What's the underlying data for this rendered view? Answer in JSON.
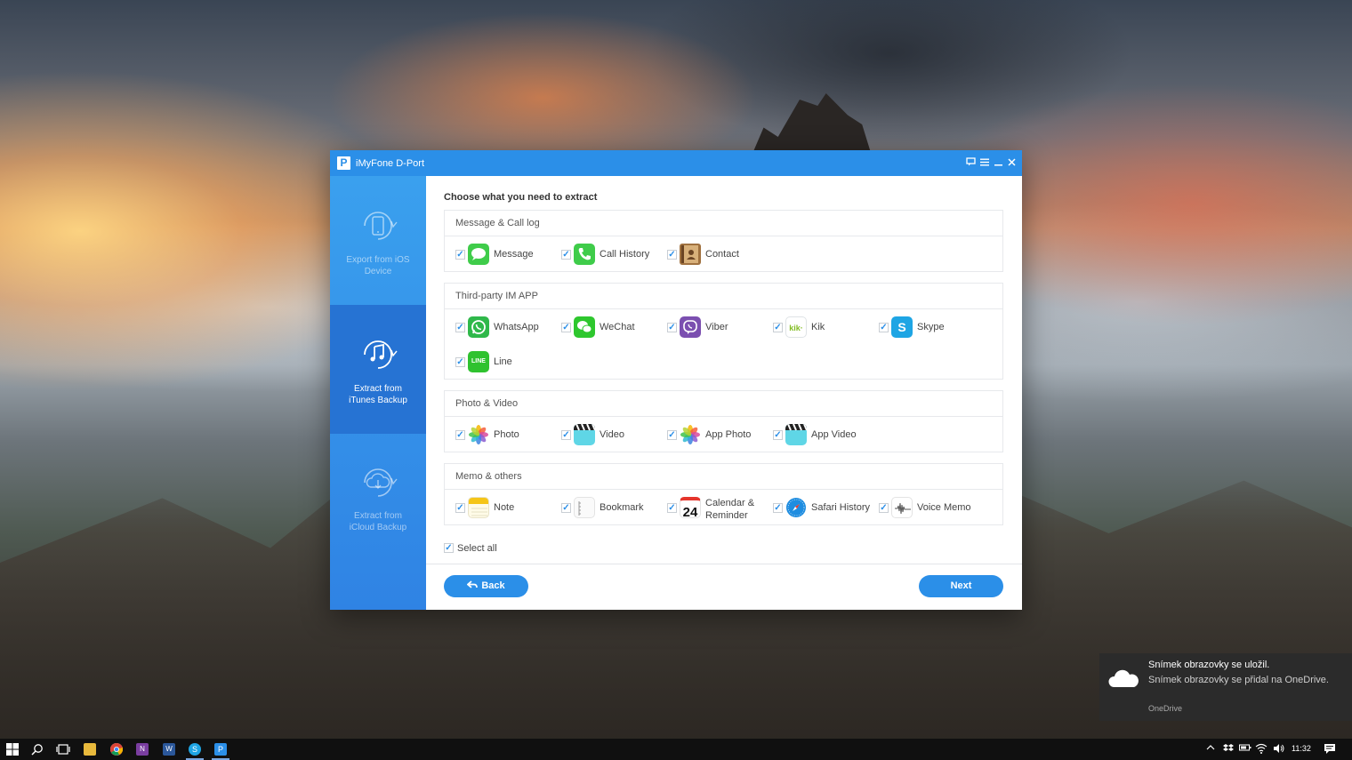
{
  "window": {
    "title": "iMyFone D-Port"
  },
  "sidebar": [
    {
      "label": "Export from iOS Device",
      "icon": "phone-sync-icon",
      "active": false
    },
    {
      "label": "Extract from iTunes Backup",
      "icon": "music-note-sync-icon",
      "active": true
    },
    {
      "label": "Extract from iCloud Backup",
      "icon": "cloud-download-icon",
      "active": false
    }
  ],
  "main": {
    "heading": "Choose what you need to extract",
    "groups": [
      {
        "title": "Message & Call log",
        "items": [
          {
            "label": "Message",
            "icon": "message-icon",
            "checked": true
          },
          {
            "label": "Call History",
            "icon": "phone-icon",
            "checked": true
          },
          {
            "label": "Contact",
            "icon": "contact-book-icon",
            "checked": true
          }
        ]
      },
      {
        "title": "Third-party IM APP",
        "items": [
          {
            "label": "WhatsApp",
            "icon": "whatsapp-icon",
            "checked": true
          },
          {
            "label": "WeChat",
            "icon": "wechat-icon",
            "checked": true
          },
          {
            "label": "Viber",
            "icon": "viber-icon",
            "checked": true
          },
          {
            "label": "Kik",
            "icon": "kik-icon",
            "icon_text": "kik·",
            "checked": true
          },
          {
            "label": "Skype",
            "icon": "skype-icon",
            "icon_text": "S",
            "checked": true
          },
          {
            "label": "Line",
            "icon": "line-icon",
            "icon_text": "LINE",
            "checked": true
          }
        ]
      },
      {
        "title": "Photo & Video",
        "items": [
          {
            "label": "Photo",
            "icon": "photos-icon",
            "checked": true
          },
          {
            "label": "Video",
            "icon": "clapperboard-icon",
            "checked": true
          },
          {
            "label": "App Photo",
            "icon": "photos-icon",
            "checked": true
          },
          {
            "label": "App Video",
            "icon": "clapperboard-icon",
            "checked": true
          }
        ]
      },
      {
        "title": "Memo & others",
        "items": [
          {
            "label": "Note",
            "icon": "notes-icon",
            "checked": true
          },
          {
            "label": "Bookmark",
            "icon": "bookmark-icon",
            "checked": true
          },
          {
            "label": "Calendar & Reminder",
            "icon": "calendar-icon",
            "icon_text": "24",
            "checked": true
          },
          {
            "label": "Safari History",
            "icon": "safari-compass-icon",
            "checked": true
          },
          {
            "label": "Voice Memo",
            "icon": "voice-memo-icon",
            "checked": true
          }
        ]
      }
    ],
    "select_all": {
      "label": "Select all",
      "checked": true
    },
    "back_label": "Back",
    "next_label": "Next"
  },
  "toast": {
    "title": "Snímek obrazovky se uložil.",
    "body": "Snímek obrazovky se přidal na OneDrive.",
    "source": "OneDrive"
  },
  "taskbar": {
    "clock": "11:32",
    "apps": [
      "start-icon",
      "search-icon",
      "task-view-icon",
      "file-explorer-icon",
      "chrome-icon",
      "onenote-icon",
      "word-icon",
      "skype-icon",
      "d-port-icon"
    ]
  },
  "colors": {
    "accent": "#2b8fe8",
    "sidebar_active": "#2673d3"
  }
}
